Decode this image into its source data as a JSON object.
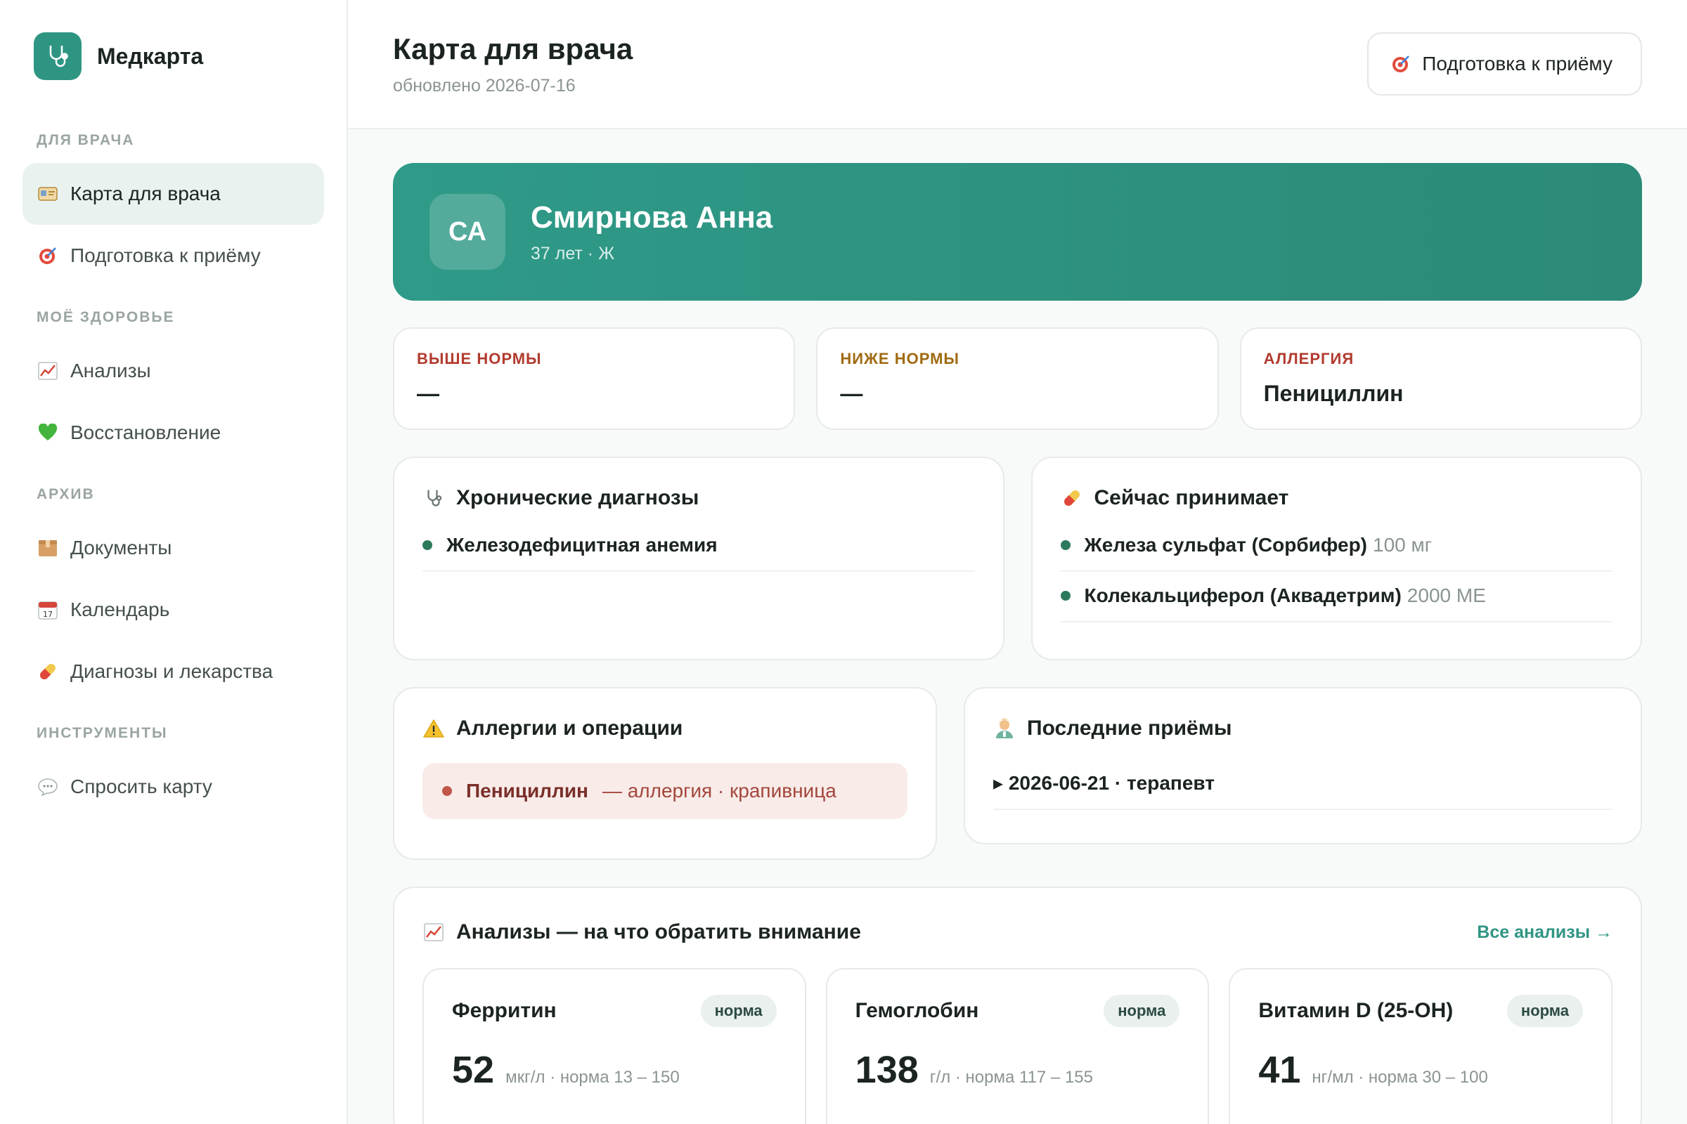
{
  "brand": {
    "name": "Медкарта",
    "logo_icon": "stethoscope-icon",
    "color": "#2f9583"
  },
  "sidebar": {
    "sections": [
      {
        "title": "ДЛЯ ВРАЧА",
        "items": [
          {
            "label": "Карта для врача",
            "icon": "id-card-icon",
            "active": true
          },
          {
            "label": "Подготовка к приёму",
            "icon": "target-icon",
            "active": false
          }
        ]
      },
      {
        "title": "МОЁ ЗДОРОВЬЕ",
        "items": [
          {
            "label": "Анализы",
            "icon": "chart-icon",
            "active": false
          },
          {
            "label": "Восстановление",
            "icon": "heart-icon",
            "active": false
          }
        ]
      },
      {
        "title": "АРХИВ",
        "items": [
          {
            "label": "Документы",
            "icon": "box-icon",
            "active": false
          },
          {
            "label": "Календарь",
            "icon": "calendar-icon",
            "active": false
          },
          {
            "label": "Диагнозы и лекарства",
            "icon": "pill-icon",
            "active": false
          }
        ]
      },
      {
        "title": "ИНСТРУМЕНТЫ",
        "items": [
          {
            "label": "Спросить карту",
            "icon": "chat-icon",
            "active": false
          }
        ]
      }
    ]
  },
  "header": {
    "title": "Карта для врача",
    "updated": "обновлено 2026-07-16",
    "prep_button": "Подготовка к приёму"
  },
  "patient": {
    "initials": "СА",
    "name": "Смирнова Анна",
    "meta": "37 лет · Ж"
  },
  "stats": [
    {
      "label": "ВЫШЕ НОРМЫ",
      "value": "—",
      "color": "#b23a2e"
    },
    {
      "label": "НИЖЕ НОРМЫ",
      "value": "—",
      "color": "#a06a12"
    },
    {
      "label": "АЛЛЕРГИЯ",
      "value": "Пенициллин",
      "color": "#b23a2e"
    }
  ],
  "chronic": {
    "title": "Хронические диагнозы",
    "items": [
      "Железодефицитная анемия"
    ]
  },
  "meds": {
    "title": "Сейчас принимает",
    "items": [
      {
        "name": "Железа сульфат (Сорбифер)",
        "dose": "100 мг"
      },
      {
        "name": "Колекальциферол (Аквадетрим)",
        "dose": "2000 МЕ"
      }
    ]
  },
  "allergies": {
    "title": "Аллергии и операции",
    "items": [
      {
        "name": "Пенициллин",
        "desc": "— аллергия · крапивница"
      }
    ]
  },
  "visits": {
    "title": "Последние приёмы",
    "items": [
      "▸ 2026-06-21 · терапевт"
    ]
  },
  "labs": {
    "title": "Анализы — на что обратить внимание",
    "all_link": "Все анализы →",
    "items": [
      {
        "name": "Ферритин",
        "badge": "норма",
        "value": "52",
        "unit": "мкг/л · норма 13 – 150"
      },
      {
        "name": "Гемоглобин",
        "badge": "норма",
        "value": "138",
        "unit": "г/л · норма 117 – 155"
      },
      {
        "name": "Витамин D (25-OH)",
        "badge": "норма",
        "value": "41",
        "unit": "нг/мл · норма 30 – 100"
      }
    ]
  }
}
